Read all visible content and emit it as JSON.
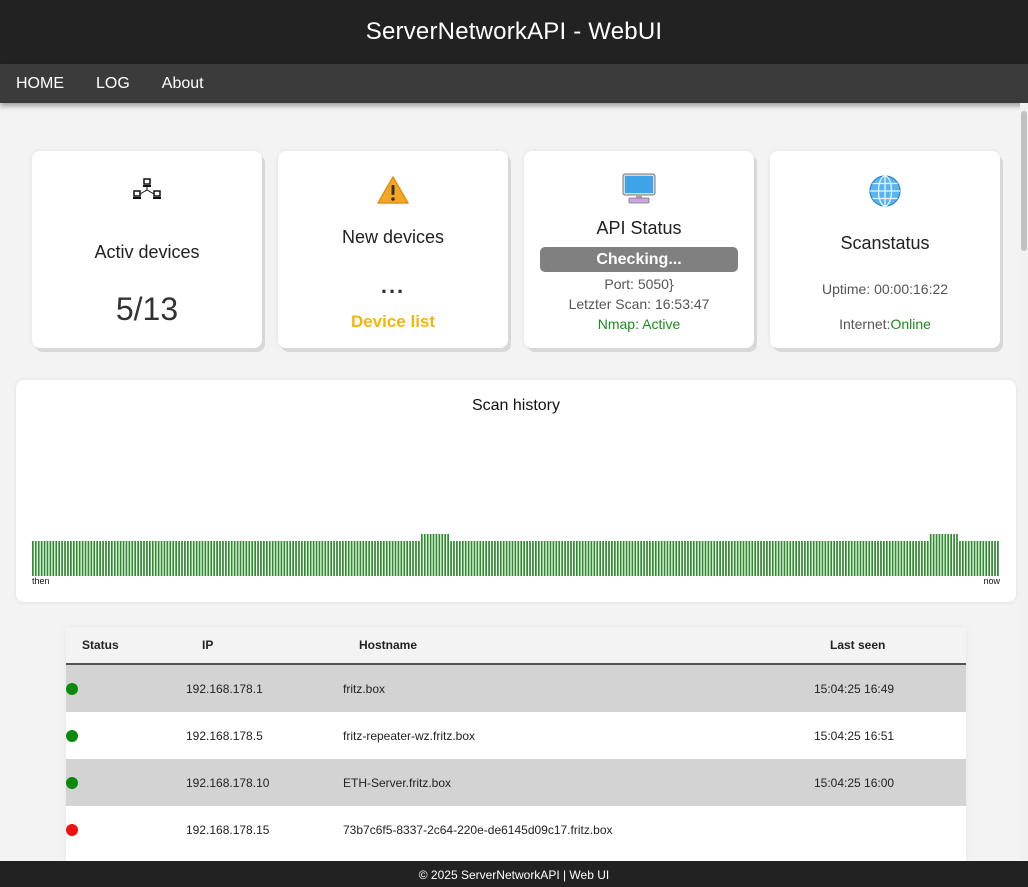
{
  "header": {
    "title": "ServerNetworkAPI - WebUI"
  },
  "nav": {
    "items": [
      "HOME",
      "LOG",
      "About"
    ]
  },
  "cards": {
    "active": {
      "icon": "network-icon",
      "title": "Activ devices",
      "count": "5/13"
    },
    "new": {
      "icon": "warning-icon",
      "title": "New devices",
      "dots": "...",
      "link": "Device list",
      "link_color": "#f5b50a"
    },
    "api": {
      "icon": "monitor-icon",
      "title": "API Status",
      "status": "Checking...",
      "port": "Port: 5050}",
      "last_scan": "Letzter Scan: 16:53:47",
      "nmap": "Nmap: Active"
    },
    "scan": {
      "icon": "globe-icon",
      "title": "Scanstatus",
      "uptime": "Uptime: 00:00:16:22",
      "internet_label": "Internet:",
      "internet_value": "Online"
    }
  },
  "history": {
    "title": "Scan history",
    "start_label": "then",
    "end_label": "now",
    "bar_color": "#2e8b2e",
    "segments": [
      {
        "count": 133,
        "level": 5
      },
      {
        "count": 10,
        "level": 6
      },
      {
        "count": 164,
        "level": 5
      },
      {
        "count": 10,
        "level": 6
      },
      {
        "count": 14,
        "level": 5
      }
    ]
  },
  "table": {
    "headers": {
      "status": "Status",
      "ip": "IP",
      "hostname": "Hostname",
      "last_seen": "Last seen"
    },
    "rows": [
      {
        "online": true,
        "ip": "192.168.178.1",
        "hostname": "fritz.box",
        "last_seen": "15:04:25 16:49"
      },
      {
        "online": true,
        "ip": "192.168.178.5",
        "hostname": "fritz-repeater-wz.fritz.box",
        "last_seen": "15:04:25 16:51"
      },
      {
        "online": true,
        "ip": "192.168.178.10",
        "hostname": "ETH-Server.fritz.box",
        "last_seen": "15:04:25 16:00"
      },
      {
        "online": false,
        "ip": "192.168.178.15",
        "hostname": "73b7c6f5-8337-2c64-220e-de6145d09c17.fritz.box",
        "last_seen": ""
      }
    ],
    "online_color": "#0a8a0a",
    "offline_color": "#ee1111"
  },
  "footer": {
    "text": "© 2025 ServerNetworkAPI | Web UI"
  }
}
